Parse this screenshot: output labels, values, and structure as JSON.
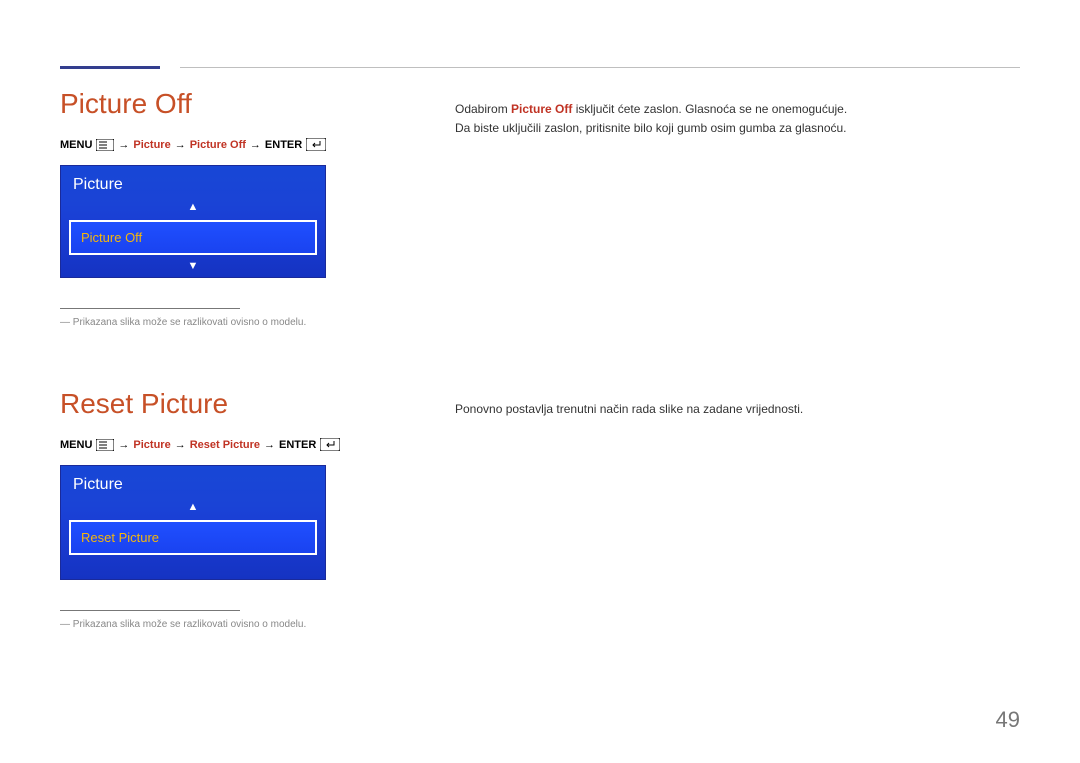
{
  "page": {
    "number": "49"
  },
  "section1": {
    "heading": "Picture Off",
    "breadcrumb": {
      "menu_label": "MENU",
      "arrow1": "→",
      "item1": "Picture",
      "arrow2": "→",
      "item2": "Picture Off",
      "arrow3": "→",
      "enter_label": "ENTER"
    },
    "osd": {
      "title": "Picture",
      "selected": "Picture Off"
    },
    "footnote": "Prikazana slika može se razlikovati ovisno o modelu.",
    "right_line1_pre": "Odabirom ",
    "right_line1_bold": "Picture Off",
    "right_line1_post": " isključit ćete zaslon. Glasnoća se ne onemogućuje.",
    "right_line2": "Da biste uključili zaslon, pritisnite bilo koji gumb osim gumba za glasnoću."
  },
  "section2": {
    "heading": "Reset Picture",
    "breadcrumb": {
      "menu_label": "MENU",
      "arrow1": "→",
      "item1": "Picture",
      "arrow2": "→",
      "item2": "Reset Picture",
      "arrow3": "→",
      "enter_label": "ENTER"
    },
    "osd": {
      "title": "Picture",
      "selected": "Reset Picture"
    },
    "footnote": "Prikazana slika može se razlikovati ovisno o modelu.",
    "right_line": "Ponovno postavlja trenutni način rada slike na zadane vrijednosti."
  }
}
